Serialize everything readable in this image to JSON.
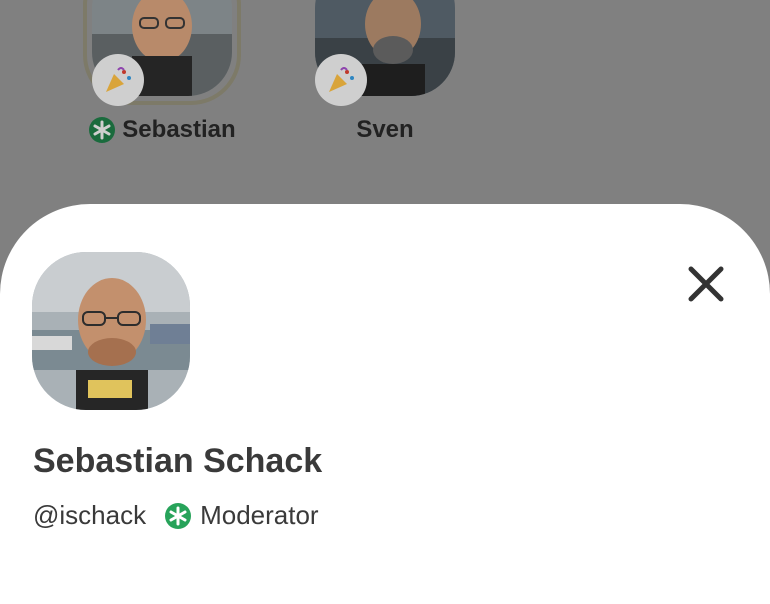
{
  "speakers": [
    {
      "name": "Sebastian",
      "is_moderator": true,
      "badge_icon": "party-popper-icon",
      "active": true
    },
    {
      "name": "Sven",
      "is_moderator": false,
      "badge_icon": "party-popper-icon",
      "active": false
    }
  ],
  "profile": {
    "full_name": "Sebastian Schack",
    "username": "@ischack",
    "role": "Moderator"
  },
  "colors": {
    "moderator_green": "#27a35a",
    "backdrop": "#808080",
    "sheet": "#ffffff",
    "text": "#3a3a3a"
  },
  "icons": {
    "close": "close-icon",
    "moderator": "moderator-asterisk-icon"
  }
}
